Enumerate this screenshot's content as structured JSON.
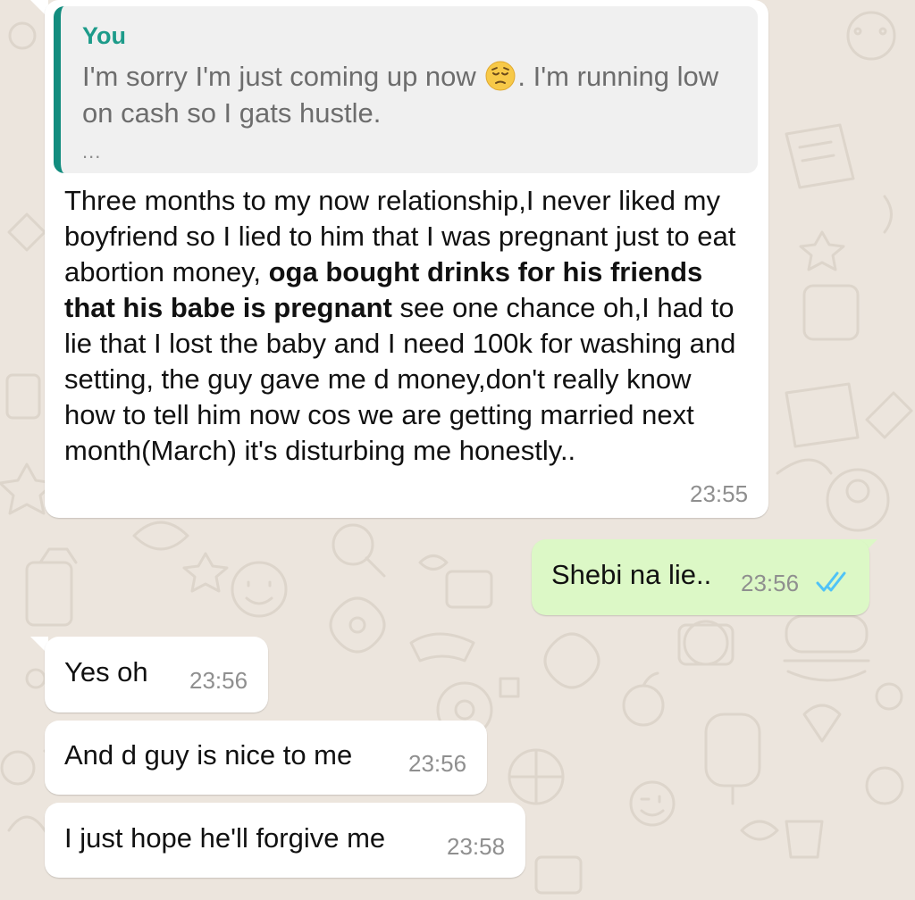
{
  "quoted": {
    "author": "You",
    "text_before_emoji": "I'm sorry I'm just coming up now ",
    "emoji": "pensive-face",
    "text_after_emoji": ". I'm running low on cash so I gats hustle.",
    "more": "..."
  },
  "messages": [
    {
      "direction": "incoming",
      "text_part1": "Three months to my now relationship,I never liked my boyfriend so I lied to him that I was pregnant just to eat abortion money, ",
      "bold": "oga bought drinks for his friends that his babe is pregnant",
      "text_part2": " see one chance oh,I had to lie that I lost the baby and I need 100k for washing and setting, the guy gave me d money,don't really know how to tell him now cos we are getting married next month(March) it's disturbing me honestly..",
      "time": "23:55"
    },
    {
      "direction": "outgoing",
      "text": "Shebi na lie..",
      "time": "23:56",
      "status": "read"
    },
    {
      "direction": "incoming",
      "text": "Yes oh",
      "time": "23:56"
    },
    {
      "direction": "incoming",
      "text": "And d guy is nice to me",
      "time": "23:56"
    },
    {
      "direction": "incoming",
      "text": "I just hope he'll forgive me",
      "time": "23:58"
    }
  ],
  "colors": {
    "background": "#ece5dd",
    "incoming_bubble": "#ffffff",
    "outgoing_bubble": "#dcf8c6",
    "quote_accent": "#128c7e",
    "read_ticks": "#4fc3f7"
  }
}
